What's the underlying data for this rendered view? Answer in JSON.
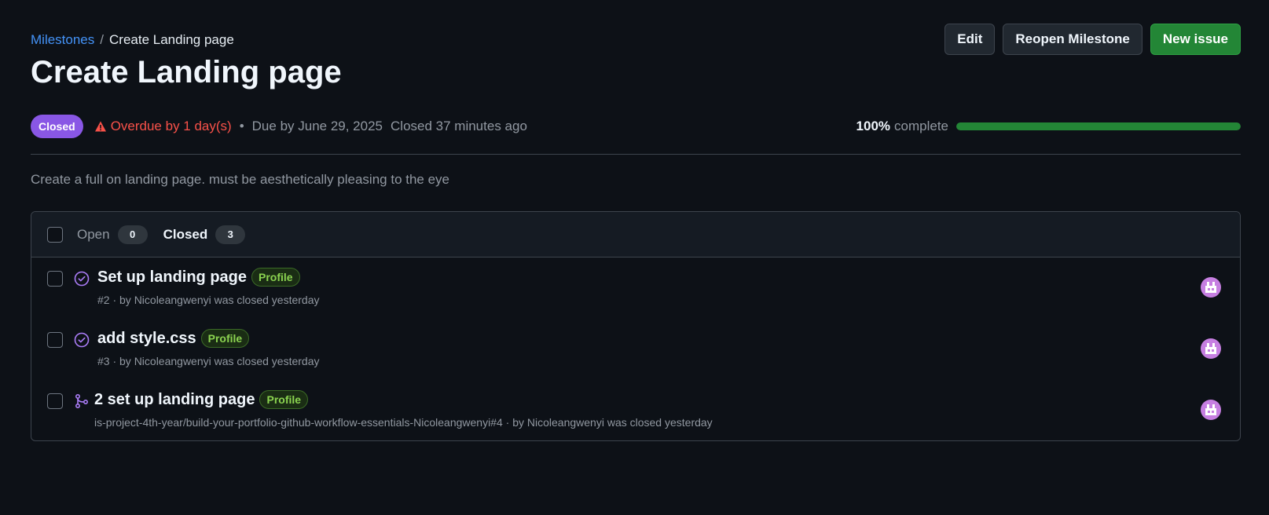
{
  "breadcrumb": {
    "parent": "Milestones",
    "separator": "/",
    "current": "Create Landing page"
  },
  "actions": {
    "edit": "Edit",
    "reopen": "Reopen Milestone",
    "new_issue": "New issue"
  },
  "title": "Create Landing page",
  "meta": {
    "state": "Closed",
    "overdue": "Overdue by 1 day(s)",
    "bullet": "•",
    "due": "Due by June 29, 2025",
    "closed_ago": "Closed 37 minutes ago",
    "percent": "100%",
    "complete_label": "complete",
    "progress": 1.0
  },
  "description": "Create a full on landing page. must be aesthetically pleasing to the eye",
  "tabs": {
    "open": {
      "label": "Open",
      "count": "0"
    },
    "closed": {
      "label": "Closed",
      "count": "3"
    }
  },
  "issues": [
    {
      "title": "Set up landing page",
      "label": "Profile",
      "sub": "#2 · by Nicoleangwenyi was closed yesterday",
      "icon": "closed-issue-icon"
    },
    {
      "title": "add style.css",
      "label": "Profile",
      "sub": "#3 · by Nicoleangwenyi was closed yesterday",
      "icon": "closed-issue-icon"
    },
    {
      "title": "2 set up landing page",
      "label": "Profile",
      "sub": "is-project-4th-year/build-your-portfolio-github-workflow-essentials-Nicoleangwenyi#4 · by Nicoleangwenyi was closed yesterday",
      "icon": "merged-pr-icon"
    }
  ],
  "colors": {
    "background": "#0d1117",
    "link": "#4493f8",
    "closed_purple": "#8957e5",
    "danger": "#f85149",
    "success": "#238636",
    "label_green": "#8bd350"
  }
}
